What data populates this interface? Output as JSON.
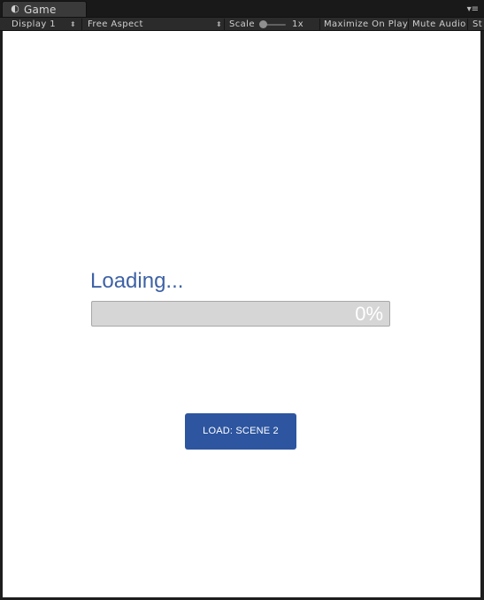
{
  "window": {
    "tab_label": "Game",
    "tab_icon": "game-controller-icon",
    "menu_icon": "tab-menu-icon"
  },
  "toolbar": {
    "display_label": "Display 1",
    "aspect_label": "Free Aspect",
    "scale_label": "Scale",
    "scale_value": "1x",
    "maximize_on_play": "Maximize On Play",
    "mute_audio": "Mute Audio",
    "stats_truncated": "St"
  },
  "game": {
    "loading_text": "Loading...",
    "progress": {
      "value": 0,
      "label": "0%"
    },
    "load_button_label": "LOAD: SCENE 2"
  },
  "colors": {
    "accent": "#3e62a6",
    "button": "#2d55a0",
    "progress_track": "#d6d6d6",
    "editor_bg": "#1e1e1e"
  }
}
